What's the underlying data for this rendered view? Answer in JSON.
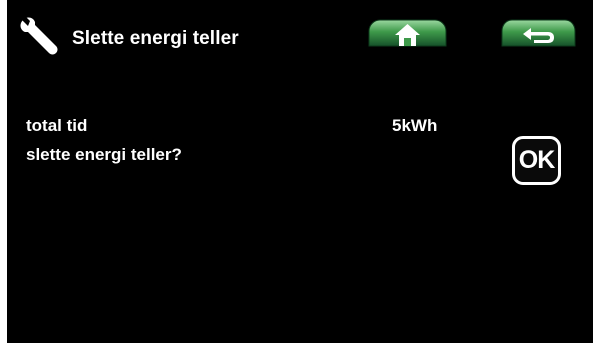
{
  "header": {
    "title": "Slette energi teller",
    "icon": "wrench-icon",
    "home_icon": "home-icon",
    "back_icon": "return-arrow-icon"
  },
  "rows": {
    "total_label": "total tid",
    "total_value": "5kWh",
    "reset_prompt": "slette energi teller?"
  },
  "ok_button": {
    "label": "OK"
  },
  "colors": {
    "background": "#000000",
    "text": "#ffffff",
    "button_green": "#3e9a4a",
    "button_green_dark": "#16522a"
  }
}
